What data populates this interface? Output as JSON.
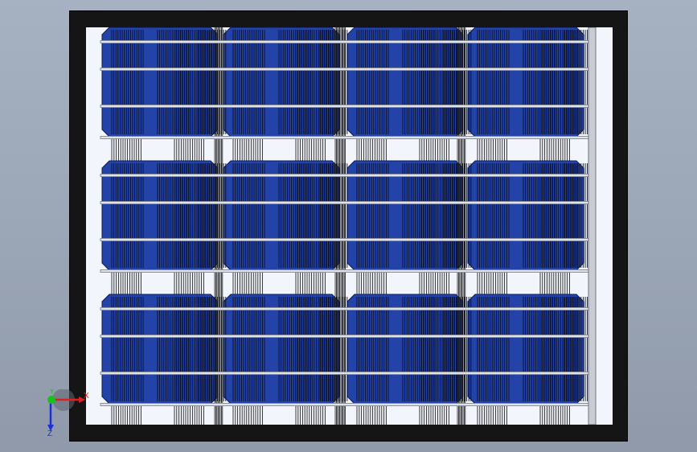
{
  "scene": {
    "panel": {
      "rows": 3,
      "cols": 4,
      "busbars_per_cell": 3,
      "frame_color": "#151515",
      "backsheet_color": "#f2f5fb",
      "cell_color": "#2343a8",
      "cell_edge_color": "#0e1c55",
      "finger_color": "#0a0f26",
      "busbar_color": "#8a8f99",
      "rail_color": "#c9ccd3"
    },
    "triad": {
      "x_label": "X",
      "y_label": "Y",
      "z_label": "Z",
      "x_color": "#e02020",
      "y_color": "#18c21b",
      "z_color": "#1a2fd8",
      "icon": "coordinate-triad-icon"
    }
  }
}
